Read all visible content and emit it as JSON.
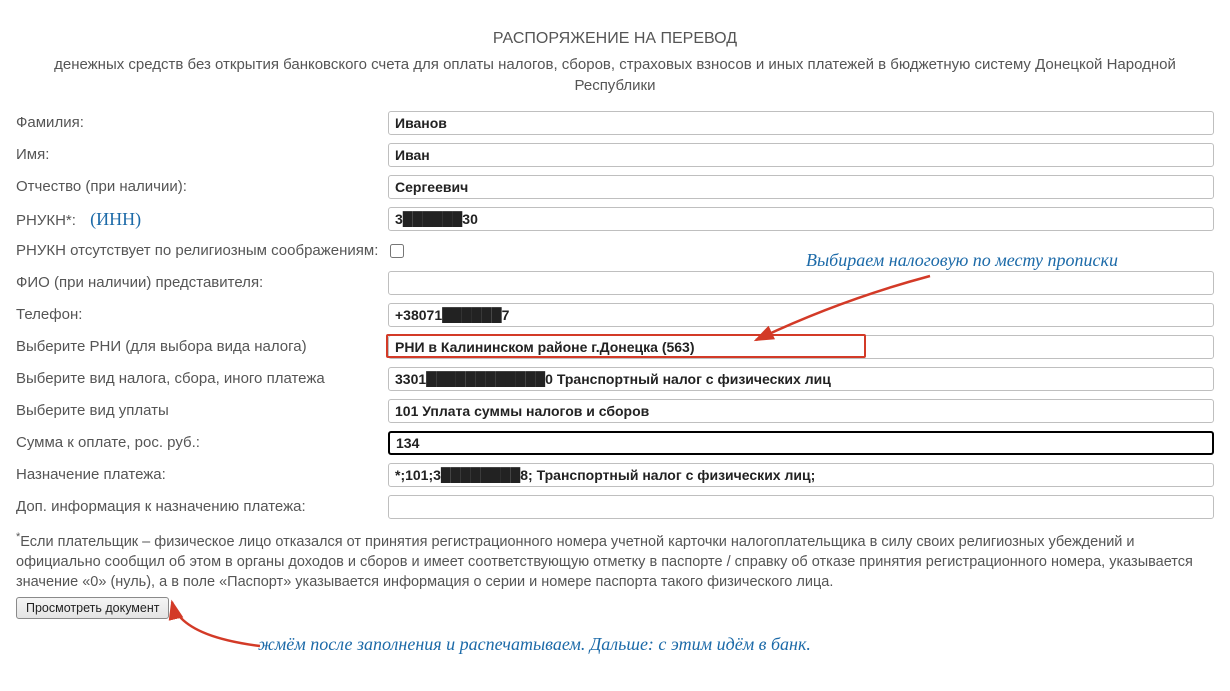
{
  "header": {
    "title": "РАСПОРЯЖЕНИЕ НА ПЕРЕВОД",
    "subtitle": "денежных средств без открытия банковского счета для оплаты налогов, сборов, страховых взносов и иных платежей в бюджетную систему Донецкой Народной Республики"
  },
  "labels": {
    "last_name": "Фамилия:",
    "first_name": "Имя:",
    "patronymic": "Отчество (при наличии):",
    "rnukn": "РНУКН*:",
    "rnukn_hint": "(ИНН)",
    "rnukn_absent": "РНУКН отсутствует по религиозным соображениям:",
    "rep_fio": "ФИО (при наличии) представителя:",
    "phone": "Телефон:",
    "select_rni": "Выберите РНИ (для выбора вида налога)",
    "select_tax": "Выберите вид налога, сбора, иного платежа",
    "select_payment": "Выберите вид уплаты",
    "amount": "Сумма к оплате, рос. руб.:",
    "purpose": "Назначение платежа:",
    "extra_purpose": "Доп. информация к назначению платежа:"
  },
  "values": {
    "last_name": "Иванов",
    "first_name": "Иван",
    "patronymic": "Сергеевич",
    "rnukn": "3██████30",
    "rep_fio": "",
    "phone": "+38071██████7",
    "rni": "РНИ в Калининском районе г.Донецка (563)",
    "tax": "3301████████████0 Транспортный налог с физических лиц",
    "payment": "101 Уплата суммы налогов и сборов",
    "amount": "134",
    "purpose": "*;101;3████████8; Транспортный налог с физических лиц;",
    "extra_purpose": ""
  },
  "footnote": "Если плательщик – физическое лицо отказался от принятия регистрационного номера учетной карточки налогоплательщика в силу своих религиозных убеждений и официально сообщил об этом в органы доходов и сборов и имеет соответствующую отметку в паспорте / справку об отказе принятия регистрационного номера, указывается значение «0» (нуль), а в поле «Паспорт» указывается информация о серии и номере паспорта такого физического лица.",
  "button": {
    "view_doc": "Просмотреть документ"
  },
  "annotations": {
    "top": "Выбираем налоговую по месту прописки",
    "bottom": "жмём после заполнения и распечатываем. Дальше: с этим идём в банк."
  }
}
